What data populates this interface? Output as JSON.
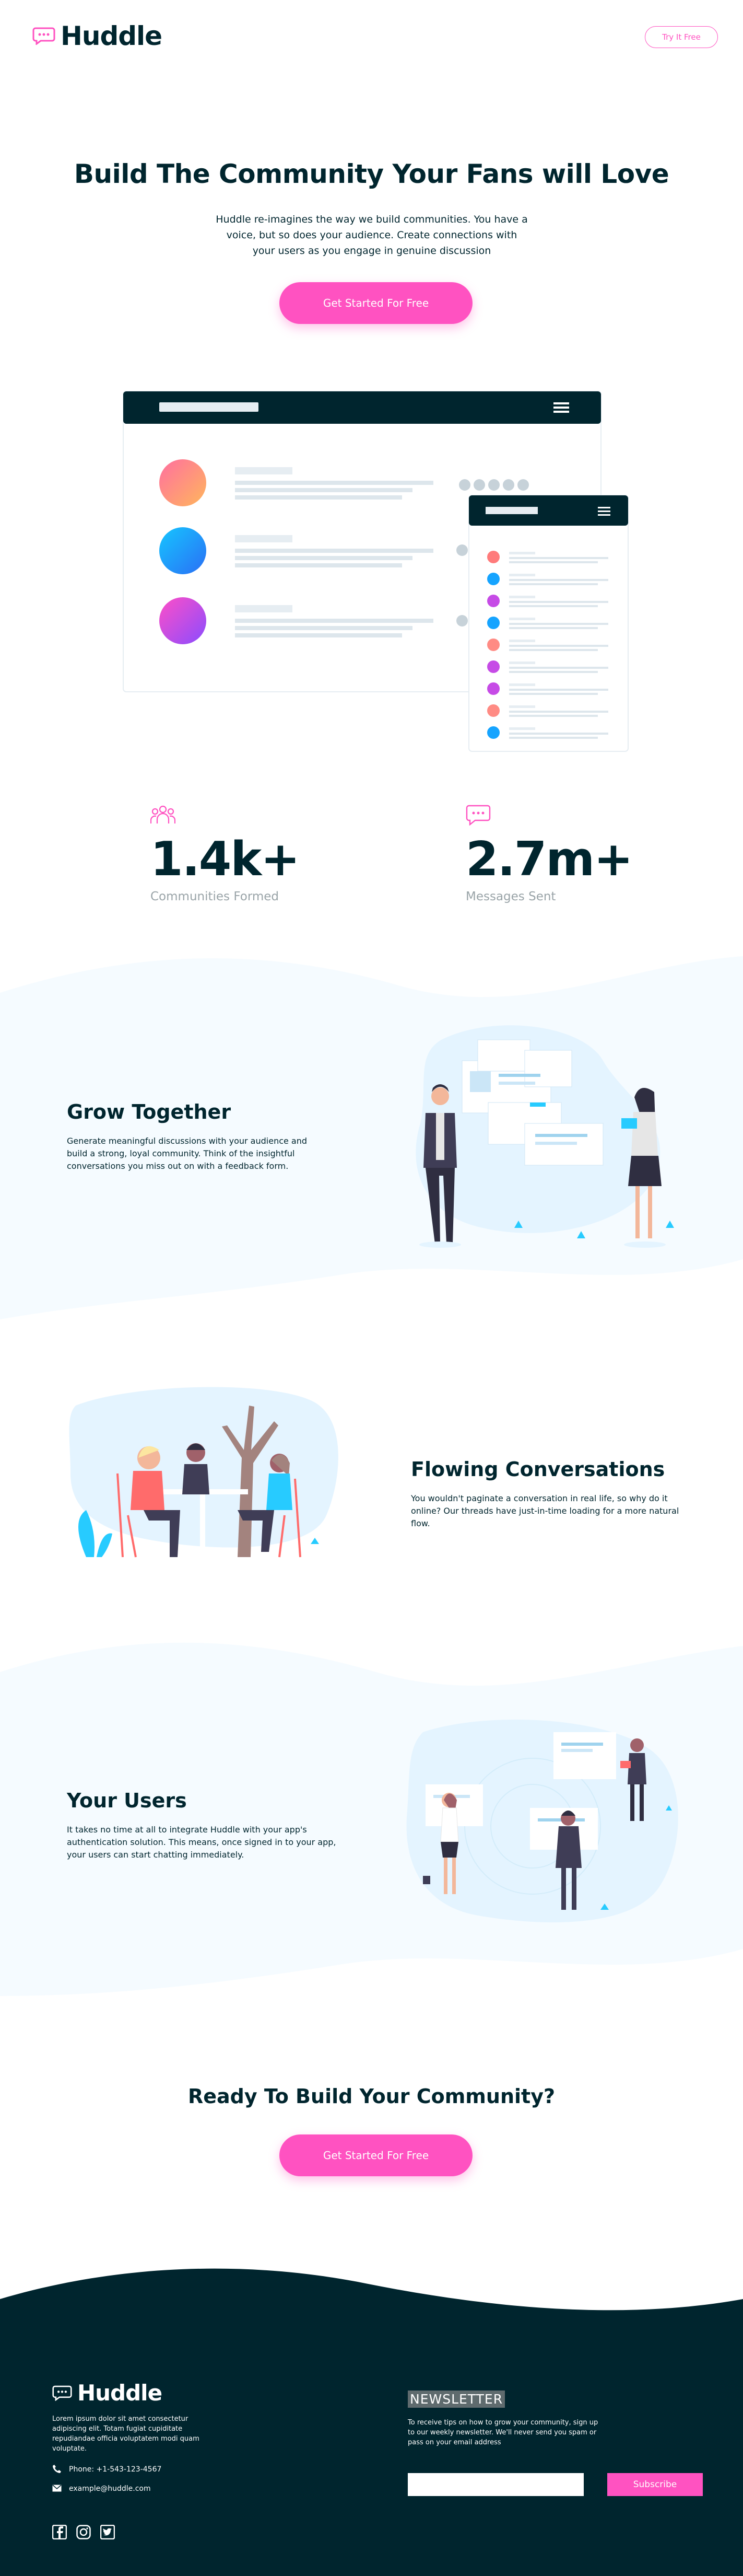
{
  "header": {
    "logo_text": "Huddle",
    "cta_label": "Try It Free"
  },
  "hero": {
    "title": "Build The Community Your Fans will Love",
    "subtitle": "Huddle re-imagines the way we build communities. You have a voice, but so does your audience. Create connections with your users as you engage in genuine discussion",
    "cta_label": "Get Started For Free"
  },
  "stats": [
    {
      "value": "1.4k+",
      "label": "Communities Formed",
      "icon": "communities-icon"
    },
    {
      "value": "2.7m+",
      "label": "Messages Sent",
      "icon": "messages-icon"
    }
  ],
  "features": [
    {
      "title": "Grow Together",
      "text": "Generate meaningful discussions with your audience and build a strong, loyal community. Think of the insightful conversations you miss out on with a feedback form."
    },
    {
      "title": "Flowing Conversations",
      "text": "You wouldn't paginate a conversation in real life, so why do it online? Our threads have just-in-time loading for a more natural flow."
    },
    {
      "title": "Your Users",
      "text": "It takes no time at all to integrate Huddle with your app's authentication solution. This means, once signed in to your app, your users can start chatting immediately."
    }
  ],
  "cta": {
    "title": "Ready To Build Your Community?",
    "button_label": "Get Started For Free"
  },
  "footer": {
    "logo_text": "Huddle",
    "about": "Lorem ipsum dolor sit amet consectetur adipiscing elit. Totam fugiat cupiditate repudiandae officia voluptatem modi quam voluptate.",
    "phone": "Phone: +1-543-123-4567",
    "email": "example@huddle.com",
    "newsletter_label": "NEWSLETTER",
    "newsletter_text": "To receive tips on how to grow your community, sign up to our weekly newsletter. We'll never send you spam or pass on your email address",
    "email_placeholder": "",
    "subscribe_label": "Subscribe",
    "social": [
      "facebook-icon",
      "instagram-icon",
      "twitter-icon"
    ]
  },
  "colors": {
    "primary": "#ff52c1",
    "dark": "#00252e",
    "light_bg": "#f5fbff"
  }
}
